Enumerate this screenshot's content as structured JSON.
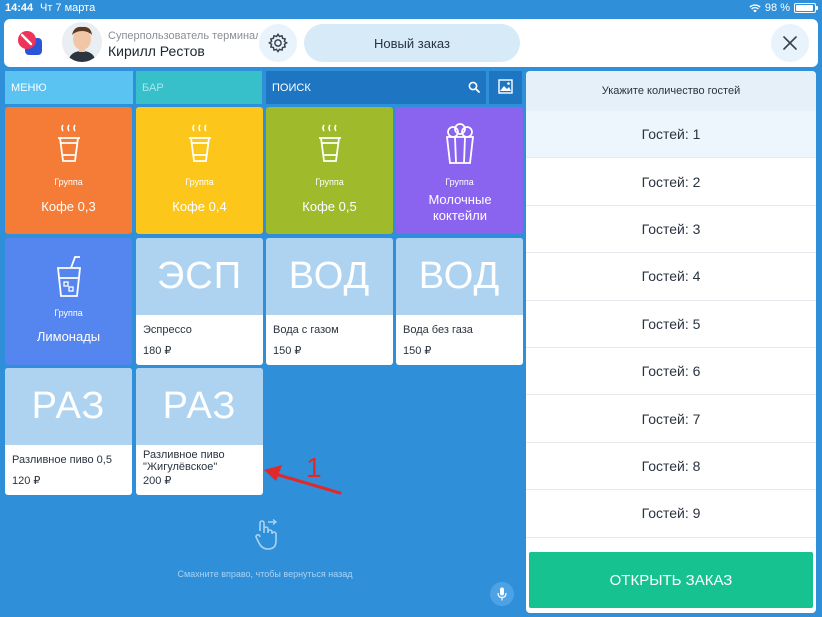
{
  "status_bar": {
    "time": "14:44",
    "date": "Чт 7 марта",
    "battery": "98 %"
  },
  "header": {
    "user_role": "Суперпользователь терминала",
    "user_name": "Кирилл Рестов",
    "new_order_label": "Новый заказ"
  },
  "tabs": {
    "menu": "МЕНЮ",
    "bar": "БАР",
    "search": "ПОИСК"
  },
  "groups": [
    {
      "label": "Группа",
      "name": "Кофе 0,3",
      "color": "#f47c36"
    },
    {
      "label": "Группа",
      "name": "Кофе 0,4",
      "color": "#fcc71a"
    },
    {
      "label": "Группа",
      "name": "Кофе 0,5",
      "color": "#9fba2a"
    },
    {
      "label": "Группа",
      "name": "Молочные коктейли",
      "color": "#8a63ef"
    },
    {
      "label": "Группа",
      "name": "Лимонады",
      "color": "#5585ee"
    }
  ],
  "products": [
    {
      "abbr": "ЭСП",
      "name": "Эспрессо",
      "price": "180 ₽"
    },
    {
      "abbr": "ВОД",
      "name": "Вода с газом",
      "price": "150 ₽"
    },
    {
      "abbr": "ВОД",
      "name": "Вода без газа",
      "price": "150 ₽"
    },
    {
      "abbr": "РАЗ",
      "name": "Разливное пиво 0,5",
      "price": "120 ₽"
    },
    {
      "abbr": "РАЗ",
      "name": "Разливное пиво \"Жигулёвское\"",
      "price": "200 ₽"
    }
  ],
  "annotation": {
    "number": "1",
    "color": "#e02a2a"
  },
  "swipe_hint": "Смахните вправо, чтобы вернуться назад",
  "guests_panel": {
    "header": "Укажите количество гостей",
    "options": [
      "Гостей: 1",
      "Гостей: 2",
      "Гостей: 3",
      "Гостей: 4",
      "Гостей: 5",
      "Гостей: 6",
      "Гостей: 7",
      "Гостей: 8",
      "Гостей: 9"
    ],
    "open_order_label": "ОТКРЫТЬ ЗАКАЗ"
  },
  "colors": {
    "background": "#2f8fd8",
    "accent_green": "#17c291"
  },
  "icons": [
    "wifi-icon",
    "battery-icon",
    "logo-icon",
    "gear-icon",
    "close-icon",
    "search-icon",
    "image-icon",
    "coffee-cup-icon",
    "popcorn-icon",
    "drink-cup-icon",
    "swipe-hand-icon",
    "mic-icon"
  ]
}
